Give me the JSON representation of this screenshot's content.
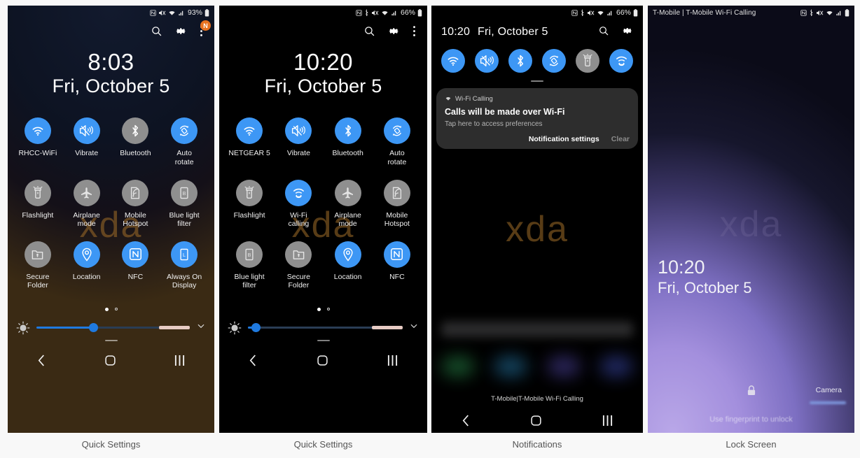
{
  "captions": [
    {
      "label": "Quick Settings"
    },
    {
      "label": "Quick Settings"
    },
    {
      "label": "Notifications"
    },
    {
      "label": "Lock Screen"
    }
  ],
  "colors": {
    "accent_blue": "#3d97f5",
    "tile_off_gray": "#8f8f8f",
    "badge_orange": "#e8721f",
    "slider_blue": "#1f7ae0"
  },
  "panel1": {
    "statusbar": {
      "icons": [
        "nfc-icon",
        "mute-icon",
        "wifi-icon",
        "signal-icon"
      ],
      "battery_percent": "93%",
      "battery_icon": "battery-icon"
    },
    "header": {
      "search_icon": "search-icon",
      "settings_icon": "gear-icon",
      "more_icon": "overflow-menu-icon",
      "badge_label": "N"
    },
    "clock": {
      "time": "8:03",
      "date": "Fri, October 5"
    },
    "watermark": "xda",
    "tiles": [
      {
        "label": "RHCC-WiFi",
        "icon": "wifi-icon",
        "state": "on"
      },
      {
        "label": "Vibrate",
        "icon": "vibrate-icon",
        "state": "on"
      },
      {
        "label": "Bluetooth",
        "icon": "bluetooth-icon",
        "state": "off"
      },
      {
        "label": "Auto\nrotate",
        "icon": "auto-rotate-icon",
        "state": "on"
      },
      {
        "label": "Flashlight",
        "icon": "flashlight-icon",
        "state": "off"
      },
      {
        "label": "Airplane\nmode",
        "icon": "airplane-icon",
        "state": "off"
      },
      {
        "label": "Mobile\nHotspot",
        "icon": "hotspot-icon",
        "state": "off"
      },
      {
        "label": "Blue light\nfilter",
        "icon": "blue-light-filter-icon",
        "state": "off"
      },
      {
        "label": "Secure\nFolder",
        "icon": "secure-folder-icon",
        "state": "off"
      },
      {
        "label": "Location",
        "icon": "location-pin-icon",
        "state": "on"
      },
      {
        "label": "NFC",
        "icon": "nfc-icon",
        "state": "on"
      },
      {
        "label": "Always On\nDisplay",
        "icon": "always-on-display-icon",
        "state": "on"
      }
    ],
    "pager": {
      "page": 1,
      "total": 2
    },
    "brightness": {
      "percent": 37,
      "icon": "brightness-icon",
      "expand_icon": "chevron-down-icon"
    },
    "navbar": {
      "back": "back-icon",
      "home": "home-icon",
      "recents": "recents-icon"
    }
  },
  "panel2": {
    "statusbar": {
      "icons": [
        "nfc-icon",
        "bluetooth-icon",
        "mute-icon",
        "wifi-icon",
        "signal-icon"
      ],
      "battery_percent": "66%",
      "battery_icon": "battery-icon"
    },
    "header": {
      "search_icon": "search-icon",
      "settings_icon": "gear-icon",
      "more_icon": "overflow-menu-icon"
    },
    "clock": {
      "time": "10:20",
      "date": "Fri, October 5"
    },
    "watermark": "xda",
    "tiles": [
      {
        "label": "NETGEAR 5",
        "icon": "wifi-icon",
        "state": "on"
      },
      {
        "label": "Vibrate",
        "icon": "vibrate-icon",
        "state": "on"
      },
      {
        "label": "Bluetooth",
        "icon": "bluetooth-icon",
        "state": "on"
      },
      {
        "label": "Auto\nrotate",
        "icon": "auto-rotate-icon",
        "state": "on"
      },
      {
        "label": "Flashlight",
        "icon": "flashlight-icon",
        "state": "off"
      },
      {
        "label": "Wi-Fi\ncalling",
        "icon": "wifi-calling-icon",
        "state": "on"
      },
      {
        "label": "Airplane\nmode",
        "icon": "airplane-icon",
        "state": "off"
      },
      {
        "label": "Mobile\nHotspot",
        "icon": "hotspot-icon",
        "state": "off"
      },
      {
        "label": "Blue light\nfilter",
        "icon": "blue-light-filter-icon",
        "state": "off"
      },
      {
        "label": "Secure\nFolder",
        "icon": "secure-folder-icon",
        "state": "off"
      },
      {
        "label": "Location",
        "icon": "location-pin-icon",
        "state": "on"
      },
      {
        "label": "NFC",
        "icon": "nfc-icon",
        "state": "on"
      }
    ],
    "pager": {
      "page": 1,
      "total": 2
    },
    "brightness": {
      "percent": 5,
      "icon": "brightness-icon",
      "expand_icon": "chevron-down-icon"
    },
    "navbar": {
      "back": "back-icon",
      "home": "home-icon",
      "recents": "recents-icon"
    }
  },
  "panel3": {
    "statusbar": {
      "icons": [
        "nfc-icon",
        "bluetooth-icon",
        "mute-icon",
        "wifi-icon",
        "signal-icon"
      ],
      "battery_percent": "66%",
      "battery_icon": "battery-icon"
    },
    "header": {
      "time": "10:20",
      "date": "Fri, October 5",
      "search_icon": "search-icon",
      "settings_icon": "gear-icon"
    },
    "toggles": [
      {
        "icon": "wifi-icon",
        "state": "on"
      },
      {
        "icon": "vibrate-icon",
        "state": "on"
      },
      {
        "icon": "bluetooth-icon",
        "state": "on"
      },
      {
        "icon": "auto-rotate-icon",
        "state": "on"
      },
      {
        "icon": "flashlight-icon",
        "state": "off"
      },
      {
        "icon": "wifi-calling-icon",
        "state": "on"
      }
    ],
    "notification": {
      "app_icon": "wifi-calling-icon",
      "app_name": "Wi-Fi Calling",
      "title": "Calls will be made over Wi-Fi",
      "subtitle": "Tap here to access preferences",
      "settings_action": "Notification settings",
      "clear_action": "Clear"
    },
    "watermark": "xda",
    "carrier_footer": "T-Mobile|T-Mobile Wi-Fi Calling",
    "navbar": {
      "back": "back-icon",
      "home": "home-icon",
      "recents": "recents-icon"
    }
  },
  "panel4": {
    "statusbar": {
      "carrier": "T-Mobile | T-Mobile Wi-Fi Calling",
      "icons": [
        "nfc-icon",
        "bluetooth-icon",
        "mute-icon",
        "wifi-icon",
        "signal-icon"
      ],
      "battery_icon": "battery-icon"
    },
    "watermark": "xda",
    "clock": {
      "time": "10:20",
      "date": "Fri, October 5"
    },
    "lock_icon": "lock-icon",
    "camera_label": "Camera",
    "hint": "Use fingerprint to unlock"
  }
}
